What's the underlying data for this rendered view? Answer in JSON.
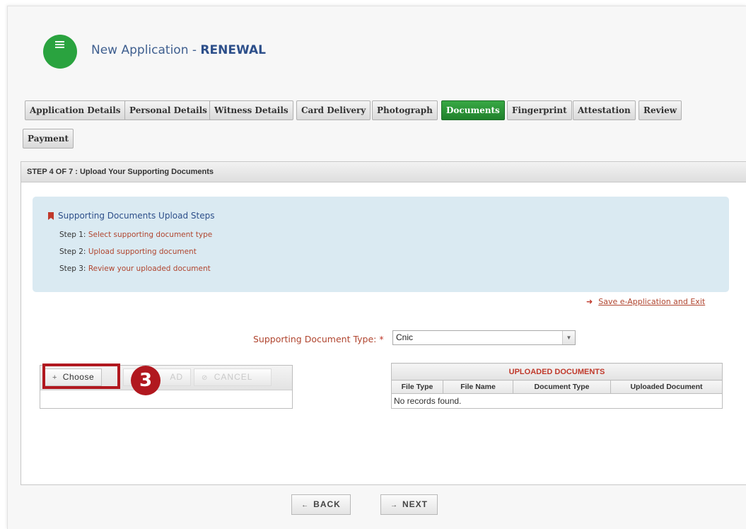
{
  "header": {
    "title_prefix": "New Application - ",
    "title_emphasis": "RENEWAL"
  },
  "tabs": [
    {
      "label": "Application Details",
      "active": false
    },
    {
      "label": "Personal Details",
      "active": false
    },
    {
      "label": "Witness Details",
      "active": false
    },
    {
      "label": "Card Delivery",
      "active": false
    },
    {
      "label": "Photograph",
      "active": false
    },
    {
      "label": "Documents",
      "active": true
    },
    {
      "label": "Fingerprint",
      "active": false
    },
    {
      "label": "Attestation",
      "active": false
    },
    {
      "label": "Review",
      "active": false
    },
    {
      "label": "Payment",
      "active": false
    }
  ],
  "step": {
    "header": "STEP 4 OF 7 : Upload Your Supporting Documents"
  },
  "info": {
    "title": "Supporting Documents Upload Steps",
    "steps": [
      {
        "label": "Step 1:",
        "text": "Select supporting document type"
      },
      {
        "label": "Step 2:",
        "text": "Upload supporting document"
      },
      {
        "label": "Step 3:",
        "text": "Review your uploaded document"
      }
    ]
  },
  "save_exit": {
    "label": "Save e-Application and Exit",
    "icon": "exit-icon"
  },
  "doc_type": {
    "label": "Supporting Document Type:",
    "required_mark": "*",
    "value": "Cnic"
  },
  "upload": {
    "choose_label": "Choose",
    "choose_icon": "+",
    "upload_label": "AD",
    "cancel_label": "CANCEL",
    "cancel_icon": "⊘"
  },
  "annotation": {
    "badge": "3",
    "color": "#b1181f"
  },
  "uploaded": {
    "caption": "UPLOADED DOCUMENTS",
    "columns": [
      "File Type",
      "File Name",
      "Document Type",
      "Uploaded Document"
    ],
    "empty_message": "No records found."
  },
  "nav": {
    "back_label": "BACK",
    "back_arrow": "←",
    "next_label": "NEXT",
    "next_arrow": "→"
  },
  "colors": {
    "active_tab": "#2a9a38",
    "link_red": "#b0452f",
    "title_blue": "#2d4f8a",
    "info_bg": "#daeaf2"
  }
}
